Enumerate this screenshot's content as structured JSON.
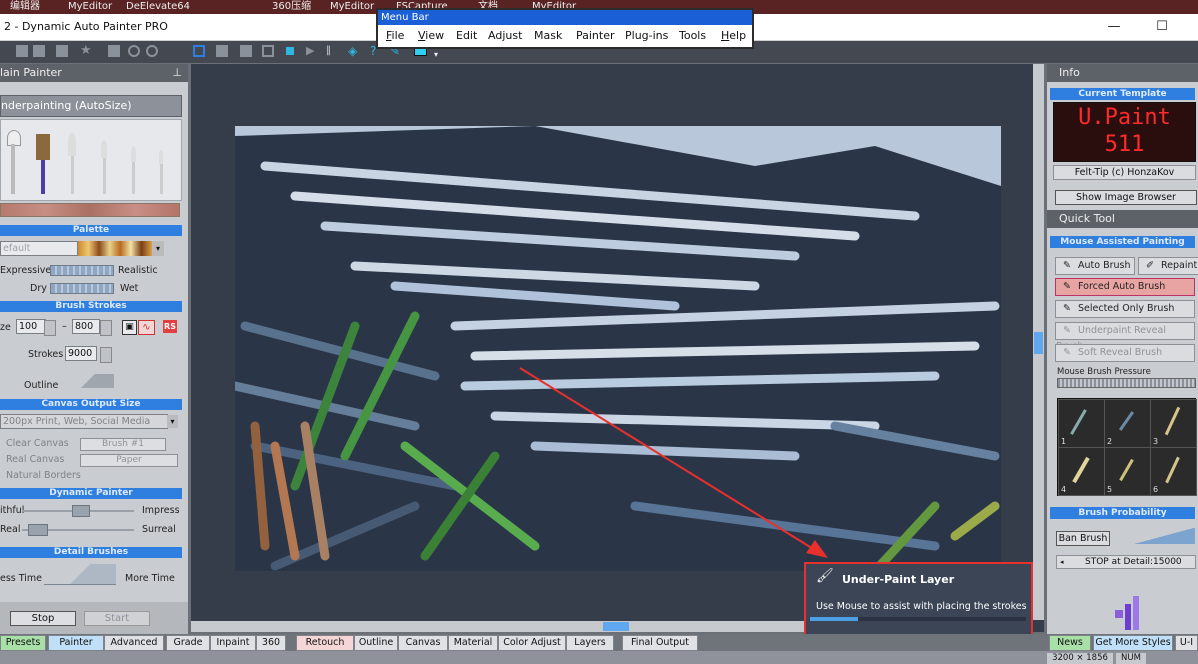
{
  "taskbar": {
    "items": [
      "编辑器",
      "MyEditor",
      "DeElevate64",
      "360压缩",
      "MyEditor",
      "FSCapture",
      "文档",
      "MyEditor"
    ]
  },
  "window": {
    "title": "2 - Dynamic Auto Painter PRO",
    "minimize": "—",
    "maximize": "☐"
  },
  "menu_popup": {
    "title": "Menu Bar",
    "items": [
      {
        "first": "F",
        "rest": "ile"
      },
      {
        "first": "V",
        "rest": "iew"
      },
      {
        "first": "",
        "rest": "Edit"
      },
      {
        "first": "",
        "rest": "Adjust"
      },
      {
        "first": "",
        "rest": "Mask"
      },
      {
        "first": "",
        "rest": "Painter"
      },
      {
        "first": "",
        "rest": "Plug-ins"
      },
      {
        "first": "",
        "rest": "Tools"
      },
      {
        "first": "H",
        "rest": "elp"
      }
    ]
  },
  "left_panel": {
    "header": "lain Painter",
    "preset": "nderpainting (AutoSize)",
    "palette": {
      "header": "Palette",
      "value": "efault",
      "left": "Expressive",
      "right": "Realistic",
      "dry": "Dry",
      "wet": "Wet"
    },
    "brush_strokes": {
      "header": "Brush Strokes",
      "size_label": "ze",
      "size_min": "100",
      "dash": "–",
      "size_max": "800",
      "rs": "RS",
      "strokes_label": "Strokes",
      "strokes_value": "9000",
      "outline_label": "Outline"
    },
    "canvas_output": {
      "header": "Canvas Output Size",
      "value": "200px Print, Web, Social Media",
      "clear_canvas": "Clear Canvas",
      "brush_button": "Brush #1",
      "real_canvas": "Real Canvas",
      "paper_button": "Paper",
      "natural_borders": "Natural Borders"
    },
    "dynamic_painter": {
      "header": "Dynamic Painter",
      "row1_left": "ithful",
      "row1_right": "Impress",
      "row2_left": "Real",
      "row2_right": "Surreal"
    },
    "detail_brushes": {
      "header": "Detail Brushes",
      "left": "ess Time",
      "right": "More Time"
    },
    "stop_button": "Stop",
    "start_button": "Start"
  },
  "right_panel": {
    "info_header": "Info",
    "current_template_header": "Current Template",
    "led_line1": "U.Paint",
    "led_line2": "511",
    "template_credit": "Felt-Tip (c) HonzaKov",
    "show_image_browser": "Show Image Browser",
    "quick_tool_header": "Quick Tool",
    "mouse_assisted_header": "Mouse Assisted Painting",
    "auto_brush": "Auto Brush",
    "repaint": "Repaint",
    "forced_auto_brush": "Forced Auto Brush",
    "selected_only_brush": "Selected Only Brush",
    "underpaint_reveal_brush": "Underpaint Reveal Brush",
    "soft_reveal_brush": "Soft Reveal Brush",
    "mouse_brush_pressure": "Mouse Brush Pressure",
    "brush_slots": [
      "1",
      "2",
      "3",
      "4",
      "5",
      "6"
    ],
    "brush_probability_header": "Brush Probability",
    "ban_brush": "Ban Brush",
    "stop_at_detail": "STOP at Detail:15000"
  },
  "tooltip": {
    "title": "Under-Paint Layer",
    "text": "Use Mouse to assist with placing the strokes"
  },
  "tabs": [
    "Presets",
    "Painter",
    "Advanced",
    "Grade",
    "Inpaint",
    "360",
    "Retouch",
    "Outline",
    "Canvas",
    "Material",
    "Color Adjust",
    "Layers",
    "Final Output"
  ],
  "right_tabs": [
    "News",
    "Get More Styles",
    "U-I"
  ],
  "status": {
    "size": "3200 × 1856",
    "num": "NUM"
  },
  "colors": {
    "accent": "#2f7fe0",
    "highlight": "#e8302c",
    "forced_auto_brush_bg": "#e8a3a3",
    "led": "#ff2a2a"
  }
}
